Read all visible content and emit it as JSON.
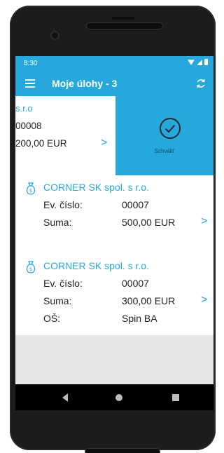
{
  "status_bar": {
    "time": "8:30"
  },
  "app_bar": {
    "title": "Moje úlohy - 3"
  },
  "swiped_task": {
    "company": "s.r.o",
    "number": "00008",
    "amount": "200,00 EUR",
    "approve_label": "Schváliť"
  },
  "tasks": [
    {
      "company": "CORNER SK spol. s r.o.",
      "ev_label": "Ev. číslo:",
      "ev_value": "00007",
      "sum_label": "Suma:",
      "sum_value": "500,00 EUR"
    },
    {
      "company": "CORNER SK spol. s r.o.",
      "ev_label": "Ev. číslo:",
      "ev_value": "00007",
      "sum_label": "Suma:",
      "sum_value": "300,00 EUR",
      "os_label": "OŠ:",
      "os_value": "Spin BA"
    }
  ],
  "icons": {
    "menu": "menu-icon",
    "refresh": "refresh-icon",
    "approve": "check-circle-icon",
    "task": "money-bag-icon",
    "chevron": "chevron-right-icon"
  },
  "colors": {
    "accent": "#27a8dc",
    "empty_area": "#e6e6e6"
  }
}
